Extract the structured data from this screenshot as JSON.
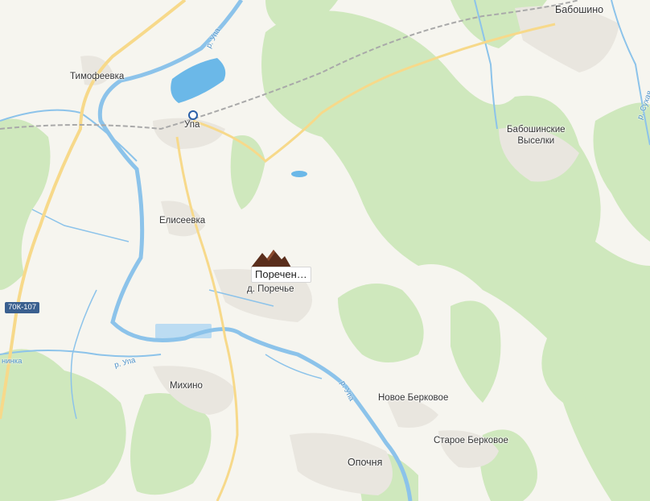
{
  "map": {
    "selected_place": {
      "label": "Поречен…",
      "icon": "mountain-marker-icon",
      "color": "#5a2e1c"
    },
    "settlements": {
      "timofeevka": "Тимофеевка",
      "upa_station": "Упа",
      "elishevka": "Елисеевка",
      "porechye": "д. Поречье",
      "mikhino": "Михино",
      "novoe_berkovoe": "Новое Берковое",
      "staroe_berkovoe": "Старое Берковое",
      "opochnya": "Опочня",
      "baboshino": "Бабошино",
      "baboshinskie_line1": "Бабошинские",
      "baboshinskie_line2": "Выселки"
    },
    "rivers": {
      "upa_north": "р. Упа",
      "upa_west": "р. Упа",
      "upa_south": "р. Упа",
      "sukhaya": "р. Сухая",
      "left_edge": "нинка"
    },
    "road_number": "70К-107",
    "colors": {
      "forest": "#cfe8bd",
      "background": "#f6f5ef",
      "water": "#6bb8e8",
      "river_line": "#8cc3ea",
      "major_road": "#f7d98a",
      "railway": "#a9a9a9",
      "settlement": "#e9e6df"
    }
  }
}
